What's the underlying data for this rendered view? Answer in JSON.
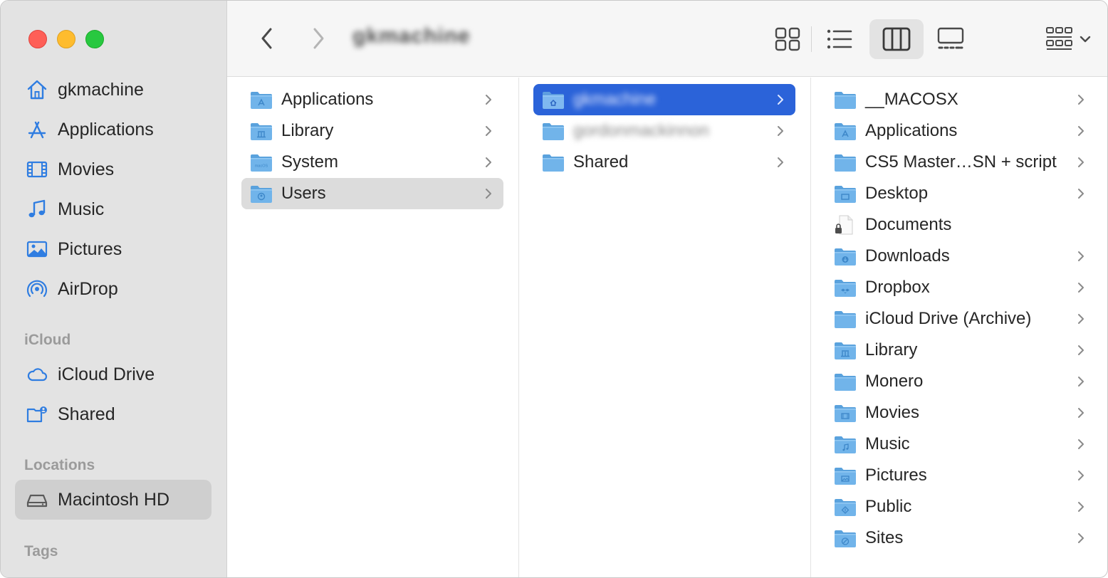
{
  "window": {
    "title": "gkmachine"
  },
  "sidebar": {
    "favorites": [
      {
        "label": "gkmachine",
        "icon": "home-icon"
      },
      {
        "label": "Applications",
        "icon": "applications-icon"
      },
      {
        "label": "Movies",
        "icon": "film-icon"
      },
      {
        "label": "Music",
        "icon": "music-note-icon"
      },
      {
        "label": "Pictures",
        "icon": "photo-icon"
      },
      {
        "label": "AirDrop",
        "icon": "airdrop-icon"
      }
    ],
    "icloud_heading": "iCloud",
    "icloud": [
      {
        "label": "iCloud Drive",
        "icon": "cloud-icon"
      },
      {
        "label": "Shared",
        "icon": "shared-folder-icon"
      }
    ],
    "locations_heading": "Locations",
    "locations": [
      {
        "label": "Macintosh HD",
        "icon": "hard-drive-icon",
        "selected": true
      }
    ],
    "tags_heading": "Tags"
  },
  "toolbar": {
    "view_buttons": [
      "icon-view",
      "list-view",
      "column-view",
      "gallery-view"
    ],
    "active_view": "column-view"
  },
  "columns": {
    "root": [
      {
        "label": "Applications",
        "icon": "applications-folder-icon"
      },
      {
        "label": "Library",
        "icon": "library-folder-icon"
      },
      {
        "label": "System",
        "icon": "system-folder-icon"
      },
      {
        "label": "Users",
        "icon": "users-folder-icon",
        "selected": true
      }
    ],
    "users": [
      {
        "label": "gkmachine",
        "icon": "home-folder-icon",
        "selected": true,
        "blurred": true
      },
      {
        "label": "gordonmackinnon",
        "icon": "folder-icon",
        "blurred": true
      },
      {
        "label": "Shared",
        "icon": "folder-icon"
      }
    ],
    "home": [
      {
        "label": "__MACOSX",
        "icon": "folder-icon",
        "chevron": true
      },
      {
        "label": "Applications",
        "icon": "applications-folder-icon",
        "chevron": true
      },
      {
        "label": "CS5 Master…SN + script",
        "icon": "folder-icon",
        "chevron": true
      },
      {
        "label": "Desktop",
        "icon": "desktop-folder-icon",
        "chevron": true
      },
      {
        "label": "Documents",
        "icon": "document-locked-icon",
        "chevron": false
      },
      {
        "label": "Downloads",
        "icon": "downloads-folder-icon",
        "chevron": true
      },
      {
        "label": "Dropbox",
        "icon": "dropbox-folder-icon",
        "chevron": true
      },
      {
        "label": "iCloud Drive (Archive)",
        "icon": "folder-icon",
        "chevron": true
      },
      {
        "label": "Library",
        "icon": "library-folder-icon",
        "chevron": true
      },
      {
        "label": "Monero",
        "icon": "folder-icon",
        "chevron": true
      },
      {
        "label": "Movies",
        "icon": "movies-folder-icon",
        "chevron": true
      },
      {
        "label": "Music",
        "icon": "music-folder-icon",
        "chevron": true
      },
      {
        "label": "Pictures",
        "icon": "pictures-folder-icon",
        "chevron": true
      },
      {
        "label": "Public",
        "icon": "public-folder-icon",
        "chevron": true
      },
      {
        "label": "Sites",
        "icon": "sites-folder-icon",
        "chevron": true
      }
    ]
  },
  "colors": {
    "accent": "#2b63d9",
    "folder": "#6fb6ec",
    "sidebar_icon": "#2f7de1"
  }
}
